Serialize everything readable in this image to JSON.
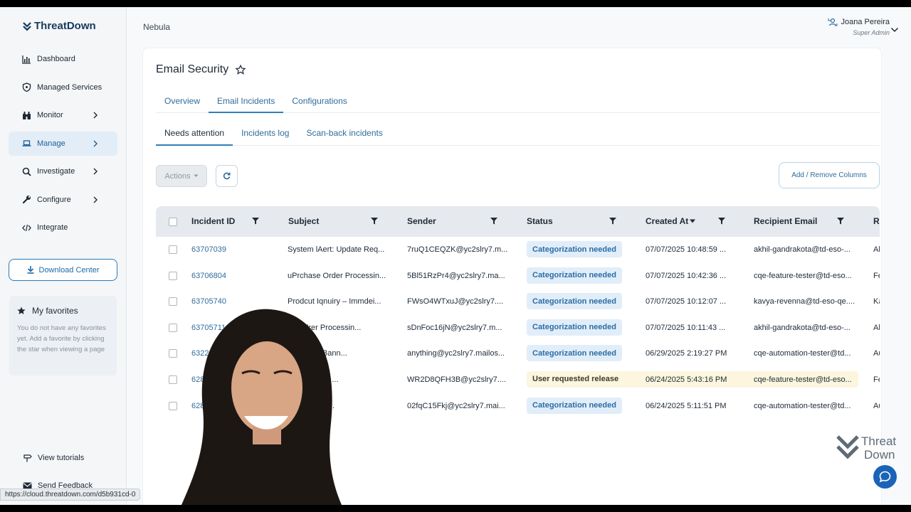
{
  "sidebar": {
    "logo": "ThreatDown",
    "items": [
      {
        "label": "Dashboard",
        "icon": "chart-bar-icon",
        "has_chevron": false
      },
      {
        "label": "Managed Services",
        "icon": "shield-icon",
        "has_chevron": false
      },
      {
        "label": "Monitor",
        "icon": "binoculars-icon",
        "has_chevron": true
      },
      {
        "label": "Manage",
        "icon": "laptop-icon",
        "has_chevron": true,
        "active": true
      },
      {
        "label": "Investigate",
        "icon": "search-icon",
        "has_chevron": true
      },
      {
        "label": "Configure",
        "icon": "wrench-icon",
        "has_chevron": true
      },
      {
        "label": "Integrate",
        "icon": "code-icon",
        "has_chevron": false
      }
    ],
    "download_center": "Download Center",
    "favorites": {
      "title": "My favorites",
      "empty_text": "You do not have any favorites yet. Add a favorite by clicking the star when viewing a page"
    },
    "view_tutorials": "View tutorials",
    "send_feedback": "Send Feedback"
  },
  "topbar": {
    "title": "Nebula",
    "user_name": "Joana Pereira",
    "user_role": "Super Admin"
  },
  "page": {
    "title": "Email Security",
    "tabs": [
      "Overview",
      "Email Incidents",
      "Configurations"
    ],
    "active_tab": "Email Incidents",
    "subtabs": [
      "Needs attention",
      "Incidents log",
      "Scan-back incidents"
    ],
    "active_subtab": "Needs attention",
    "actions_label": "Actions",
    "add_remove_columns": "Add / Remove Columns"
  },
  "table": {
    "columns": [
      "Incident ID",
      "Subject",
      "Sender",
      "Status",
      "Created At",
      "Recipient Email",
      "R"
    ],
    "rows": [
      {
        "id": "63707039",
        "subject": "System lAert: Update Req...",
        "sender": "7ruQ1CEQZK@yc2slry7.m...",
        "status": "Categorization needed",
        "status_type": "cat",
        "created": "07/07/2025 10:48:59 ...",
        "recipient": "akhil-gandrakota@td-eso-...",
        "r": "Ak"
      },
      {
        "id": "63706804",
        "subject": "uPrchase Order Processin...",
        "sender": "5Bl51RzPr4@yc2slry7.ma...",
        "status": "Categorization needed",
        "status_type": "cat",
        "created": "07/07/2025 10:42:36 ...",
        "recipient": "cqe-feature-tester@td-eso...",
        "r": "Fe"
      },
      {
        "id": "63705740",
        "subject": "Prodcut Iqnuiry – Immdei...",
        "sender": "FWsO4WTxuJ@yc2slry7....",
        "status": "Categorization needed",
        "status_type": "cat",
        "created": "07/07/2025 10:12:07 ...",
        "recipient": "kavya-revenna@td-eso-qe....",
        "r": "Ka"
      },
      {
        "id": "63705711",
        "subject": "se Odrer Processin...",
        "sender": "sDnFoc16jN@yc2slry7.m...",
        "status": "Categorization needed",
        "status_type": "cat",
        "created": "07/07/2025 10:11:43 ...",
        "recipient": "akhil-gandrakota@td-eso-...",
        "r": "Ak"
      },
      {
        "id": "6322",
        "subject": "ent Mode Bann...",
        "sender": "anything@yc2slry7.mailos...",
        "status": "Categorization needed",
        "status_type": "cat",
        "created": "06/29/2025 2:19:27 PM",
        "recipient": "cqe-automation-tester@td...",
        "r": "Au"
      },
      {
        "id": "628",
        "subject": "er: Payment ...",
        "sender": "WR2D8QFH3B@yc2slry7....",
        "status": "User requested release",
        "status_type": "user",
        "created": "06/24/2025 5:43:16 PM",
        "recipient": "cqe-feature-tester@td-eso...",
        "r": "Fe"
      },
      {
        "id": "628",
        "subject": "net Shared ...",
        "sender": "02fqC15Fkj@yc2slry7.mai...",
        "status": "Categorization needed",
        "status_type": "cat",
        "created": "06/24/2025 5:11:51 PM",
        "recipient": "cqe-automation-tester@td...",
        "r": "Au"
      }
    ]
  },
  "brand_watermark": "ThreatDown",
  "status_url": "https://cloud.threatdown.com/d5b931cd-0",
  "colors": {
    "accent": "#2f7fb9",
    "link": "#2f6d9c",
    "badge_categorization": "#e1edf8",
    "badge_user_release": "#fbf6dd"
  }
}
